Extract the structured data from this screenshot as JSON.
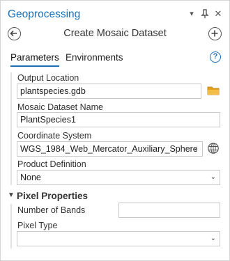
{
  "pane": {
    "title": "Geoprocessing",
    "controls": {
      "options_icon": "chevron-down-icon",
      "pin_icon": "pin-icon",
      "close_icon": "close-icon"
    }
  },
  "tool": {
    "title": "Create Mosaic Dataset",
    "back_icon": "back-icon",
    "add_icon": "add-icon"
  },
  "tabs": [
    {
      "label": "Parameters",
      "active": true
    },
    {
      "label": "Environments",
      "active": false
    }
  ],
  "help_icon": "help-icon",
  "help_symbol": "?",
  "parameters": {
    "output_location": {
      "label": "Output Location",
      "value": "plantspecies.gdb",
      "browse_icon": "folder-icon"
    },
    "mosaic_dataset_name": {
      "label": "Mosaic Dataset Name",
      "value": "PlantSpecies1"
    },
    "coordinate_system": {
      "label": "Coordinate System",
      "value": "WGS_1984_Web_Mercator_Auxiliary_Sphere",
      "globe_icon": "globe-icon"
    },
    "product_definition": {
      "label": "Product Definition",
      "value": "None"
    }
  },
  "pixel_properties": {
    "section_title": "Pixel Properties",
    "expanded": true,
    "number_of_bands": {
      "label": "Number of Bands",
      "value": ""
    },
    "pixel_type": {
      "label": "Pixel Type",
      "value": ""
    }
  },
  "colors": {
    "accent": "#1a6fb5",
    "folder": "#e6a21d"
  }
}
